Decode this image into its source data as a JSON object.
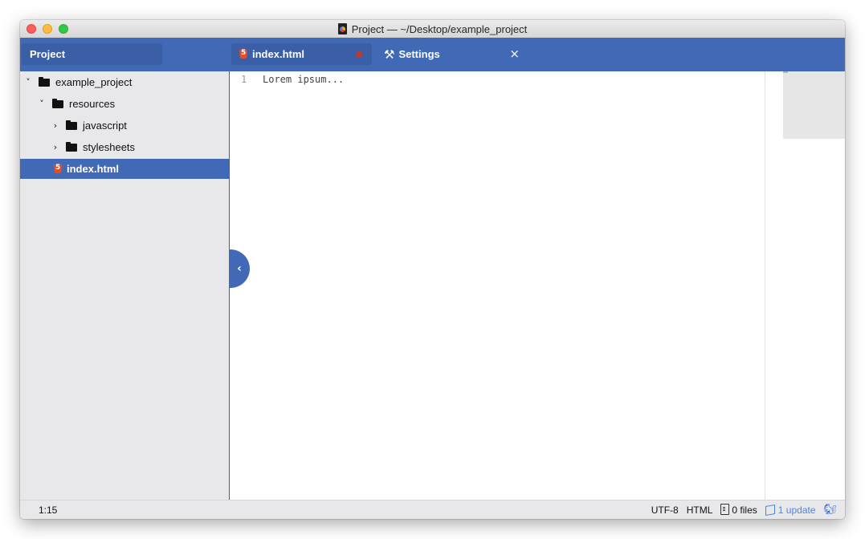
{
  "window": {
    "title": "Project — ~/Desktop/example_project"
  },
  "tabs": {
    "project_label": "Project",
    "file_tab": {
      "label": "index.html",
      "icon": "html5-icon",
      "modified": true
    },
    "settings_tab": {
      "label": "Settings",
      "icon": "tools-icon",
      "close": "×"
    }
  },
  "tree": [
    {
      "label": "example_project",
      "chevron": "˅",
      "type": "folder",
      "expanded": true
    },
    {
      "label": "resources",
      "chevron": "˅",
      "type": "folder",
      "expanded": true
    },
    {
      "label": "javascript",
      "chevron": "›",
      "type": "folder",
      "expanded": false
    },
    {
      "label": "stylesheets",
      "chevron": "›",
      "type": "folder",
      "expanded": false
    },
    {
      "label": "index.html",
      "chevron": "",
      "type": "file",
      "selected": true
    }
  ],
  "editor": {
    "line_number": "1",
    "content": "Lorem ipsum...",
    "collapse_glyph": "‹"
  },
  "status": {
    "cursor": "1:15",
    "encoding": "UTF-8",
    "grammar": "HTML",
    "files": "0 files",
    "update": "1 update"
  },
  "colors": {
    "accent": "#4169b5",
    "sidebar": "#e8e8eb",
    "update_link": "#4f86d9",
    "modified_dot": "#c0392b"
  }
}
